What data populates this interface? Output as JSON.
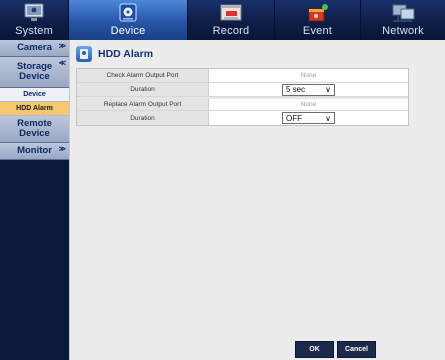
{
  "top_tabs": [
    {
      "label": "System",
      "icon": "monitor-icon",
      "active": false
    },
    {
      "label": "Device",
      "icon": "hdd-icon",
      "active": true
    },
    {
      "label": "Record",
      "icon": "record-icon",
      "active": false
    },
    {
      "label": "Event",
      "icon": "alarm-icon",
      "active": false
    },
    {
      "label": "Network",
      "icon": "network-icon",
      "active": false
    }
  ],
  "sidebar": {
    "camera": "Camera",
    "storage_device": "Storage Device",
    "device": "Device",
    "hdd_alarm": "HDD Alarm",
    "remote_device": "Remote Device",
    "monitor": "Monitor"
  },
  "page": {
    "title": "HDD Alarm",
    "title_icon": "hdd-icon"
  },
  "settings": {
    "check_alarm_output_port": {
      "label": "Check Alarm Output Port",
      "value": "None"
    },
    "check_duration": {
      "label": "Duration",
      "value": "5 sec"
    },
    "replace_alarm_output_port": {
      "label": "Replace Alarm Output Port",
      "value": "None"
    },
    "replace_duration": {
      "label": "Duration",
      "value": "OFF"
    }
  },
  "buttons": {
    "ok": "OK",
    "cancel": "Cancel"
  },
  "colors": {
    "nav_bg": "#0a1a3c",
    "active_tab": "#2756a8",
    "selected_item": "#f5c870",
    "title_text": "#14336f",
    "button_bg": "#1b2a4b"
  }
}
